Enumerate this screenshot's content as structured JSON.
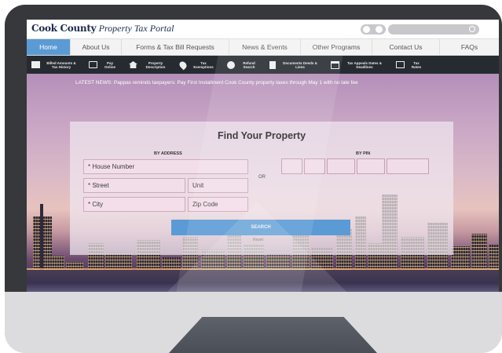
{
  "header": {
    "logo_bold": "Cook County",
    "logo_italic": "Property Tax Portal"
  },
  "nav": {
    "tabs": [
      {
        "label": "Home",
        "active": true
      },
      {
        "label": "About Us",
        "active": false
      },
      {
        "label": "Forms & Tax Bill Requests",
        "active": false
      },
      {
        "label": "News & Events",
        "active": false
      },
      {
        "label": "Other Programs",
        "active": false
      },
      {
        "label": "Contact Us",
        "active": false
      },
      {
        "label": "FAQs",
        "active": false
      }
    ]
  },
  "subnav": {
    "items": [
      {
        "icon": "folder-icon",
        "label": "Billed Amounts & Tax History"
      },
      {
        "icon": "monitor-icon",
        "label": "Pay Online"
      },
      {
        "icon": "home-icon",
        "label": "Property Description"
      },
      {
        "icon": "location-pin-icon",
        "label": "Tax Exemptions"
      },
      {
        "icon": "gear-icon",
        "label": "Refund Search"
      },
      {
        "icon": "document-icon",
        "label": "Documents Deeds & Liens"
      },
      {
        "icon": "calendar-icon",
        "label": "Tax Appeals Dates & Deadlines"
      },
      {
        "icon": "chart-icon",
        "label": "Tax Rates"
      }
    ]
  },
  "news": {
    "prefix": "LATEST NEWS:",
    "text": "Pappas reminds taxpayers: Pay First Installment Cook County property taxes through May 1 with no late fee"
  },
  "search_form": {
    "title": "Find Your Property",
    "by_address_label": "BY ADDRESS",
    "by_pin_label": "BY PIN",
    "or_label": "OR",
    "house_number_placeholder": "* House Number",
    "street_placeholder": "* Street",
    "unit_placeholder": "Unit",
    "city_placeholder": "* City",
    "zip_placeholder": "Zip Code",
    "search_button": "SEARCH",
    "reset_link": "Reset"
  },
  "colors": {
    "accent": "#5b9bd5",
    "subnav_bg": "#262b31",
    "logo": "#1d2a4d"
  }
}
